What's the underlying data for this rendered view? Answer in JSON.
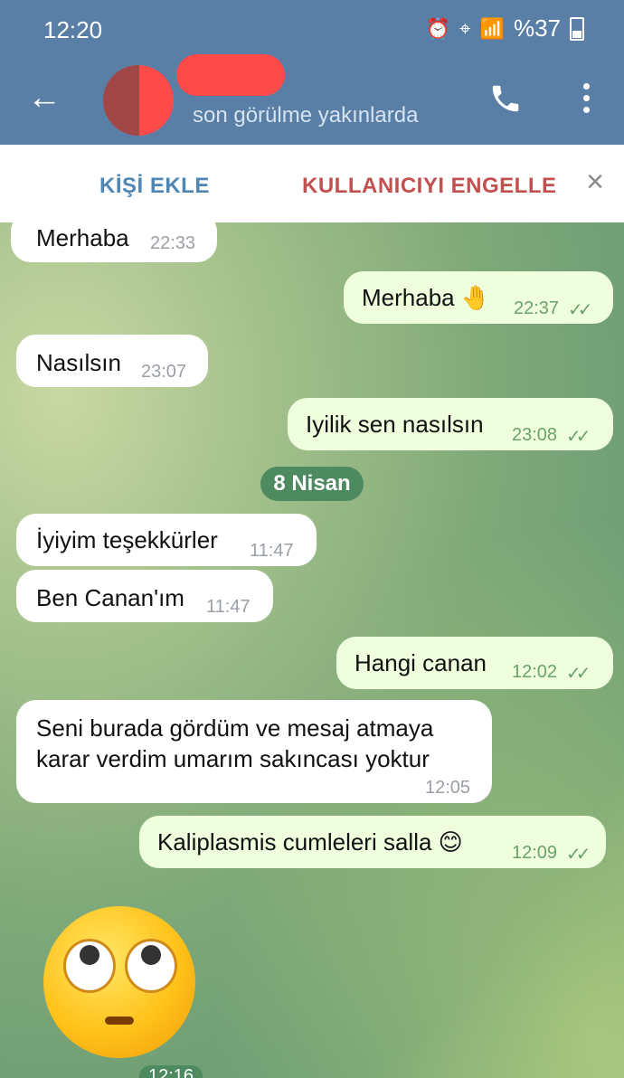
{
  "status_bar": {
    "time": "12:20",
    "battery": "%37",
    "network": "LTE2"
  },
  "header": {
    "status": "son görülme yakınlarda"
  },
  "actions": {
    "add_contact": "KİŞİ EKLE",
    "block_user": "KULLANICIYI ENGELLE",
    "close": "×"
  },
  "messages": [
    {
      "dir": "in",
      "text": "Merhaba",
      "time": "22:33"
    },
    {
      "dir": "out",
      "text": "Merhaba 🤚",
      "time": "22:37"
    },
    {
      "dir": "in",
      "text": "Nasılsın",
      "time": "23:07"
    },
    {
      "dir": "out",
      "text": "Iyilik sen nasılsın",
      "time": "23:08"
    },
    {
      "dir": "in",
      "text": "İyiyim teşekkürler",
      "time": "11:47"
    },
    {
      "dir": "in",
      "text": "Ben Canan'ım",
      "time": "11:47"
    },
    {
      "dir": "out",
      "text": "Hangi canan",
      "time": "12:02"
    },
    {
      "dir": "in",
      "text": "Seni burada gördüm ve mesaj atmaya",
      "text2": "karar verdim umarım sakıncası yoktur",
      "time": "12:05"
    },
    {
      "dir": "out",
      "text": "Kaliplasmis cumleleri salla 😊",
      "time": "12:09"
    }
  ],
  "date_separator": "8 Nisan",
  "last_time": "12:16",
  "ticks": "✓✓"
}
